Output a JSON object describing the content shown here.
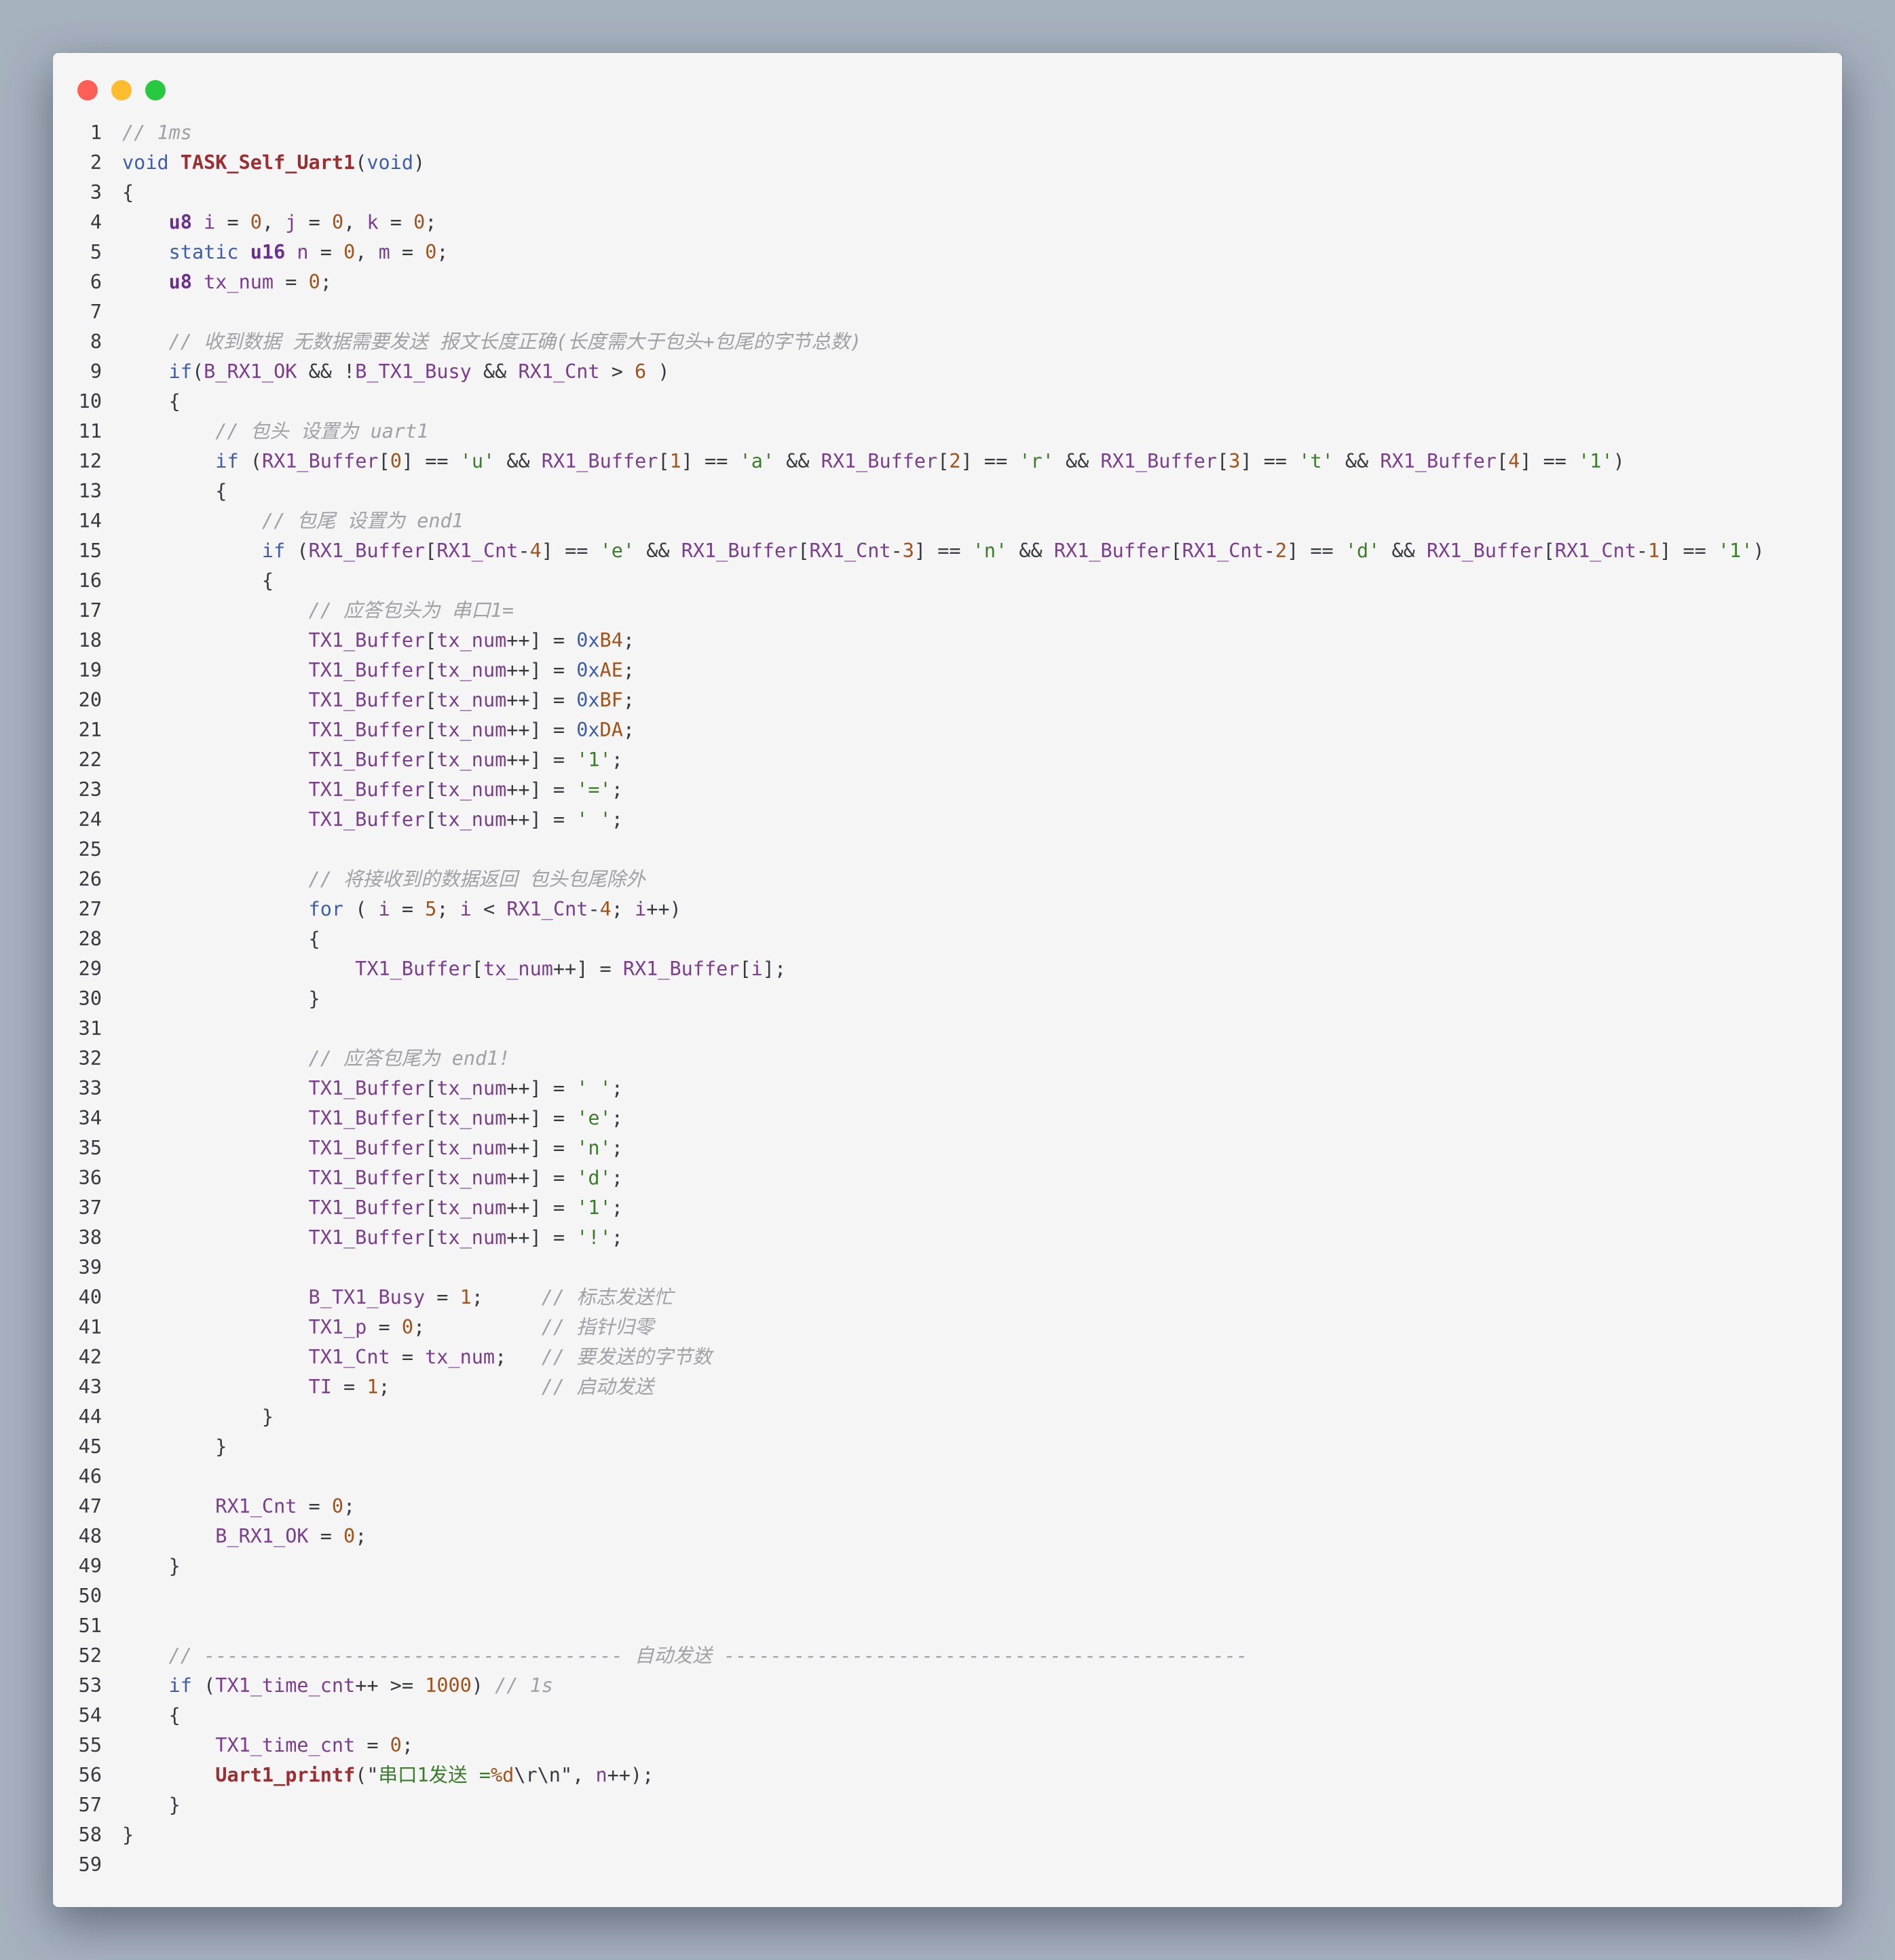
{
  "window": {
    "controls": [
      {
        "name": "close",
        "color": "#ff5f57"
      },
      {
        "name": "minimize",
        "color": "#febc2e"
      },
      {
        "name": "zoom",
        "color": "#28c840"
      }
    ]
  },
  "lines": [
    [
      [
        "cm",
        "// 1ms"
      ]
    ],
    [
      [
        "kw",
        "void "
      ],
      [
        "fn",
        "TASK_Self_Uart1"
      ],
      [
        "pl",
        "("
      ],
      [
        "kw",
        "void"
      ],
      [
        "pl",
        ")"
      ]
    ],
    [
      [
        "pl",
        "{"
      ]
    ],
    [
      [
        "pl",
        "    "
      ],
      [
        "ty",
        "u8"
      ],
      [
        "pl",
        " "
      ],
      [
        "va",
        "i"
      ],
      [
        "pl",
        " = "
      ],
      [
        "nu",
        "0"
      ],
      [
        "pl",
        ", "
      ],
      [
        "va",
        "j"
      ],
      [
        "pl",
        " = "
      ],
      [
        "nu",
        "0"
      ],
      [
        "pl",
        ", "
      ],
      [
        "va",
        "k"
      ],
      [
        "pl",
        " = "
      ],
      [
        "nu",
        "0"
      ],
      [
        "pl",
        ";"
      ]
    ],
    [
      [
        "pl",
        "    "
      ],
      [
        "kw",
        "static"
      ],
      [
        "pl",
        " "
      ],
      [
        "ty",
        "u16"
      ],
      [
        "pl",
        " "
      ],
      [
        "va",
        "n"
      ],
      [
        "pl",
        " = "
      ],
      [
        "nu",
        "0"
      ],
      [
        "pl",
        ", "
      ],
      [
        "va",
        "m"
      ],
      [
        "pl",
        " = "
      ],
      [
        "nu",
        "0"
      ],
      [
        "pl",
        ";"
      ]
    ],
    [
      [
        "pl",
        "    "
      ],
      [
        "ty",
        "u8"
      ],
      [
        "pl",
        " "
      ],
      [
        "va",
        "tx_num"
      ],
      [
        "pl",
        " = "
      ],
      [
        "nu",
        "0"
      ],
      [
        "pl",
        ";"
      ]
    ],
    [],
    [
      [
        "pl",
        "    "
      ],
      [
        "cm",
        "// 收到数据 无数据需要发送 报文长度正确(长度需大于包头+包尾的字节总数)"
      ]
    ],
    [
      [
        "pl",
        "    "
      ],
      [
        "kw",
        "if"
      ],
      [
        "pl",
        "("
      ],
      [
        "va",
        "B_RX1_OK"
      ],
      [
        "pl",
        " && !"
      ],
      [
        "va",
        "B_TX1_Busy"
      ],
      [
        "pl",
        " && "
      ],
      [
        "va",
        "RX1_Cnt"
      ],
      [
        "pl",
        " > "
      ],
      [
        "nu",
        "6"
      ],
      [
        "pl",
        " )"
      ]
    ],
    [
      [
        "pl",
        "    {"
      ]
    ],
    [
      [
        "pl",
        "        "
      ],
      [
        "cm",
        "// 包头 设置为 uart1"
      ]
    ],
    [
      [
        "pl",
        "        "
      ],
      [
        "kw",
        "if"
      ],
      [
        "pl",
        " ("
      ],
      [
        "va",
        "RX1_Buffer"
      ],
      [
        "pl",
        "["
      ],
      [
        "nu",
        "0"
      ],
      [
        "pl",
        "] == "
      ],
      [
        "st",
        "'u'"
      ],
      [
        "pl",
        " && "
      ],
      [
        "va",
        "RX1_Buffer"
      ],
      [
        "pl",
        "["
      ],
      [
        "nu",
        "1"
      ],
      [
        "pl",
        "] == "
      ],
      [
        "st",
        "'a'"
      ],
      [
        "pl",
        " && "
      ],
      [
        "va",
        "RX1_Buffer"
      ],
      [
        "pl",
        "["
      ],
      [
        "nu",
        "2"
      ],
      [
        "pl",
        "] == "
      ],
      [
        "st",
        "'r'"
      ],
      [
        "pl",
        " && "
      ],
      [
        "va",
        "RX1_Buffer"
      ],
      [
        "pl",
        "["
      ],
      [
        "nu",
        "3"
      ],
      [
        "pl",
        "] == "
      ],
      [
        "st",
        "'t'"
      ],
      [
        "pl",
        " && "
      ],
      [
        "va",
        "RX1_Buffer"
      ],
      [
        "pl",
        "["
      ],
      [
        "nu",
        "4"
      ],
      [
        "pl",
        "] == "
      ],
      [
        "st",
        "'1'"
      ],
      [
        "pl",
        ")"
      ]
    ],
    [
      [
        "pl",
        "        {"
      ]
    ],
    [
      [
        "pl",
        "            "
      ],
      [
        "cm",
        "// 包尾 设置为 end1"
      ]
    ],
    [
      [
        "pl",
        "            "
      ],
      [
        "kw",
        "if"
      ],
      [
        "pl",
        " ("
      ],
      [
        "va",
        "RX1_Buffer"
      ],
      [
        "pl",
        "["
      ],
      [
        "va",
        "RX1_Cnt"
      ],
      [
        "pl",
        "-"
      ],
      [
        "nu",
        "4"
      ],
      [
        "pl",
        "] == "
      ],
      [
        "st",
        "'e'"
      ],
      [
        "pl",
        " && "
      ],
      [
        "va",
        "RX1_Buffer"
      ],
      [
        "pl",
        "["
      ],
      [
        "va",
        "RX1_Cnt"
      ],
      [
        "pl",
        "-"
      ],
      [
        "nu",
        "3"
      ],
      [
        "pl",
        "] == "
      ],
      [
        "st",
        "'n'"
      ],
      [
        "pl",
        " && "
      ],
      [
        "va",
        "RX1_Buffer"
      ],
      [
        "pl",
        "["
      ],
      [
        "va",
        "RX1_Cnt"
      ],
      [
        "pl",
        "-"
      ],
      [
        "nu",
        "2"
      ],
      [
        "pl",
        "] == "
      ],
      [
        "st",
        "'d'"
      ],
      [
        "pl",
        " && "
      ],
      [
        "va",
        "RX1_Buffer"
      ],
      [
        "pl",
        "["
      ],
      [
        "va",
        "RX1_Cnt"
      ],
      [
        "pl",
        "-"
      ],
      [
        "nu",
        "1"
      ],
      [
        "pl",
        "] == "
      ],
      [
        "st",
        "'1'"
      ],
      [
        "pl",
        ")"
      ]
    ],
    [
      [
        "pl",
        "            {"
      ]
    ],
    [
      [
        "pl",
        "                "
      ],
      [
        "cm",
        "// 应答包头为 串口1="
      ]
    ],
    [
      [
        "pl",
        "                "
      ],
      [
        "va",
        "TX1_Buffer"
      ],
      [
        "pl",
        "["
      ],
      [
        "va",
        "tx_num"
      ],
      [
        "pl",
        "++] = "
      ],
      [
        "hx",
        "0x"
      ],
      [
        "nu",
        "B4"
      ],
      [
        "pl",
        ";"
      ]
    ],
    [
      [
        "pl",
        "                "
      ],
      [
        "va",
        "TX1_Buffer"
      ],
      [
        "pl",
        "["
      ],
      [
        "va",
        "tx_num"
      ],
      [
        "pl",
        "++] = "
      ],
      [
        "hx",
        "0x"
      ],
      [
        "nu",
        "AE"
      ],
      [
        "pl",
        ";"
      ]
    ],
    [
      [
        "pl",
        "                "
      ],
      [
        "va",
        "TX1_Buffer"
      ],
      [
        "pl",
        "["
      ],
      [
        "va",
        "tx_num"
      ],
      [
        "pl",
        "++] = "
      ],
      [
        "hx",
        "0x"
      ],
      [
        "nu",
        "BF"
      ],
      [
        "pl",
        ";"
      ]
    ],
    [
      [
        "pl",
        "                "
      ],
      [
        "va",
        "TX1_Buffer"
      ],
      [
        "pl",
        "["
      ],
      [
        "va",
        "tx_num"
      ],
      [
        "pl",
        "++] = "
      ],
      [
        "hx",
        "0x"
      ],
      [
        "nu",
        "DA"
      ],
      [
        "pl",
        ";"
      ]
    ],
    [
      [
        "pl",
        "                "
      ],
      [
        "va",
        "TX1_Buffer"
      ],
      [
        "pl",
        "["
      ],
      [
        "va",
        "tx_num"
      ],
      [
        "pl",
        "++] = "
      ],
      [
        "st",
        "'1'"
      ],
      [
        "pl",
        ";"
      ]
    ],
    [
      [
        "pl",
        "                "
      ],
      [
        "va",
        "TX1_Buffer"
      ],
      [
        "pl",
        "["
      ],
      [
        "va",
        "tx_num"
      ],
      [
        "pl",
        "++] = "
      ],
      [
        "st",
        "'='"
      ],
      [
        "pl",
        ";"
      ]
    ],
    [
      [
        "pl",
        "                "
      ],
      [
        "va",
        "TX1_Buffer"
      ],
      [
        "pl",
        "["
      ],
      [
        "va",
        "tx_num"
      ],
      [
        "pl",
        "++] = "
      ],
      [
        "st",
        "' '"
      ],
      [
        "pl",
        ";"
      ]
    ],
    [],
    [
      [
        "pl",
        "                "
      ],
      [
        "cm",
        "// 将接收到的数据返回 包头包尾除外"
      ]
    ],
    [
      [
        "pl",
        "                "
      ],
      [
        "kw",
        "for"
      ],
      [
        "pl",
        " ( "
      ],
      [
        "va",
        "i"
      ],
      [
        "pl",
        " = "
      ],
      [
        "nu",
        "5"
      ],
      [
        "pl",
        "; "
      ],
      [
        "va",
        "i"
      ],
      [
        "pl",
        " < "
      ],
      [
        "va",
        "RX1_Cnt"
      ],
      [
        "pl",
        "-"
      ],
      [
        "nu",
        "4"
      ],
      [
        "pl",
        "; "
      ],
      [
        "va",
        "i"
      ],
      [
        "pl",
        "++)"
      ]
    ],
    [
      [
        "pl",
        "                {"
      ]
    ],
    [
      [
        "pl",
        "                    "
      ],
      [
        "va",
        "TX1_Buffer"
      ],
      [
        "pl",
        "["
      ],
      [
        "va",
        "tx_num"
      ],
      [
        "pl",
        "++] = "
      ],
      [
        "va",
        "RX1_Buffer"
      ],
      [
        "pl",
        "["
      ],
      [
        "va",
        "i"
      ],
      [
        "pl",
        "];"
      ]
    ],
    [
      [
        "pl",
        "                }"
      ]
    ],
    [],
    [
      [
        "pl",
        "                "
      ],
      [
        "cm",
        "// 应答包尾为 end1!"
      ]
    ],
    [
      [
        "pl",
        "                "
      ],
      [
        "va",
        "TX1_Buffer"
      ],
      [
        "pl",
        "["
      ],
      [
        "va",
        "tx_num"
      ],
      [
        "pl",
        "++] = "
      ],
      [
        "st",
        "' '"
      ],
      [
        "pl",
        ";"
      ]
    ],
    [
      [
        "pl",
        "                "
      ],
      [
        "va",
        "TX1_Buffer"
      ],
      [
        "pl",
        "["
      ],
      [
        "va",
        "tx_num"
      ],
      [
        "pl",
        "++] = "
      ],
      [
        "st",
        "'e'"
      ],
      [
        "pl",
        ";"
      ]
    ],
    [
      [
        "pl",
        "                "
      ],
      [
        "va",
        "TX1_Buffer"
      ],
      [
        "pl",
        "["
      ],
      [
        "va",
        "tx_num"
      ],
      [
        "pl",
        "++] = "
      ],
      [
        "st",
        "'n'"
      ],
      [
        "pl",
        ";"
      ]
    ],
    [
      [
        "pl",
        "                "
      ],
      [
        "va",
        "TX1_Buffer"
      ],
      [
        "pl",
        "["
      ],
      [
        "va",
        "tx_num"
      ],
      [
        "pl",
        "++] = "
      ],
      [
        "st",
        "'d'"
      ],
      [
        "pl",
        ";"
      ]
    ],
    [
      [
        "pl",
        "                "
      ],
      [
        "va",
        "TX1_Buffer"
      ],
      [
        "pl",
        "["
      ],
      [
        "va",
        "tx_num"
      ],
      [
        "pl",
        "++] = "
      ],
      [
        "st",
        "'1'"
      ],
      [
        "pl",
        ";"
      ]
    ],
    [
      [
        "pl",
        "                "
      ],
      [
        "va",
        "TX1_Buffer"
      ],
      [
        "pl",
        "["
      ],
      [
        "va",
        "tx_num"
      ],
      [
        "pl",
        "++] = "
      ],
      [
        "st",
        "'!'"
      ],
      [
        "pl",
        ";"
      ]
    ],
    [],
    [
      [
        "pl",
        "                "
      ],
      [
        "va",
        "B_TX1_Busy"
      ],
      [
        "pl",
        " = "
      ],
      [
        "nu",
        "1"
      ],
      [
        "pl",
        ";     "
      ],
      [
        "cm",
        "// 标志发送忙"
      ]
    ],
    [
      [
        "pl",
        "                "
      ],
      [
        "va",
        "TX1_p"
      ],
      [
        "pl",
        " = "
      ],
      [
        "nu",
        "0"
      ],
      [
        "pl",
        ";          "
      ],
      [
        "cm",
        "// 指针归零"
      ]
    ],
    [
      [
        "pl",
        "                "
      ],
      [
        "va",
        "TX1_Cnt"
      ],
      [
        "pl",
        " = "
      ],
      [
        "va",
        "tx_num"
      ],
      [
        "pl",
        ";   "
      ],
      [
        "cm",
        "// 要发送的字节数"
      ]
    ],
    [
      [
        "pl",
        "                "
      ],
      [
        "va",
        "TI"
      ],
      [
        "pl",
        " = "
      ],
      [
        "nu",
        "1"
      ],
      [
        "pl",
        ";             "
      ],
      [
        "cm",
        "// 启动发送"
      ]
    ],
    [
      [
        "pl",
        "            }"
      ]
    ],
    [
      [
        "pl",
        "        }"
      ]
    ],
    [],
    [
      [
        "pl",
        "        "
      ],
      [
        "va",
        "RX1_Cnt"
      ],
      [
        "pl",
        " = "
      ],
      [
        "nu",
        "0"
      ],
      [
        "pl",
        ";"
      ]
    ],
    [
      [
        "pl",
        "        "
      ],
      [
        "va",
        "B_RX1_OK"
      ],
      [
        "pl",
        " = "
      ],
      [
        "nu",
        "0"
      ],
      [
        "pl",
        ";"
      ]
    ],
    [
      [
        "pl",
        "    }"
      ]
    ],
    [],
    [],
    [
      [
        "pl",
        "    "
      ],
      [
        "cm",
        "// ------------------------------------ 自动发送 ---------------------------------------------"
      ]
    ],
    [
      [
        "pl",
        "    "
      ],
      [
        "kw",
        "if"
      ],
      [
        "pl",
        " ("
      ],
      [
        "va",
        "TX1_time_cnt"
      ],
      [
        "pl",
        "++ >= "
      ],
      [
        "nu",
        "1000"
      ],
      [
        "pl",
        ") "
      ],
      [
        "cm",
        "// 1s"
      ]
    ],
    [
      [
        "pl",
        "    {"
      ]
    ],
    [
      [
        "pl",
        "        "
      ],
      [
        "va",
        "TX1_time_cnt"
      ],
      [
        "pl",
        " = "
      ],
      [
        "nu",
        "0"
      ],
      [
        "pl",
        ";"
      ]
    ],
    [
      [
        "pl",
        "        "
      ],
      [
        "fn",
        "Uart1_printf"
      ],
      [
        "pl",
        "(\""
      ],
      [
        "st",
        "串口1发送 ="
      ],
      [
        "nu",
        "%d"
      ],
      [
        "pl",
        "\\r\\n\", "
      ],
      [
        "va",
        "n"
      ],
      [
        "pl",
        "++);"
      ]
    ],
    [
      [
        "pl",
        "    }"
      ]
    ],
    [
      [
        "pl",
        "}"
      ]
    ],
    []
  ]
}
